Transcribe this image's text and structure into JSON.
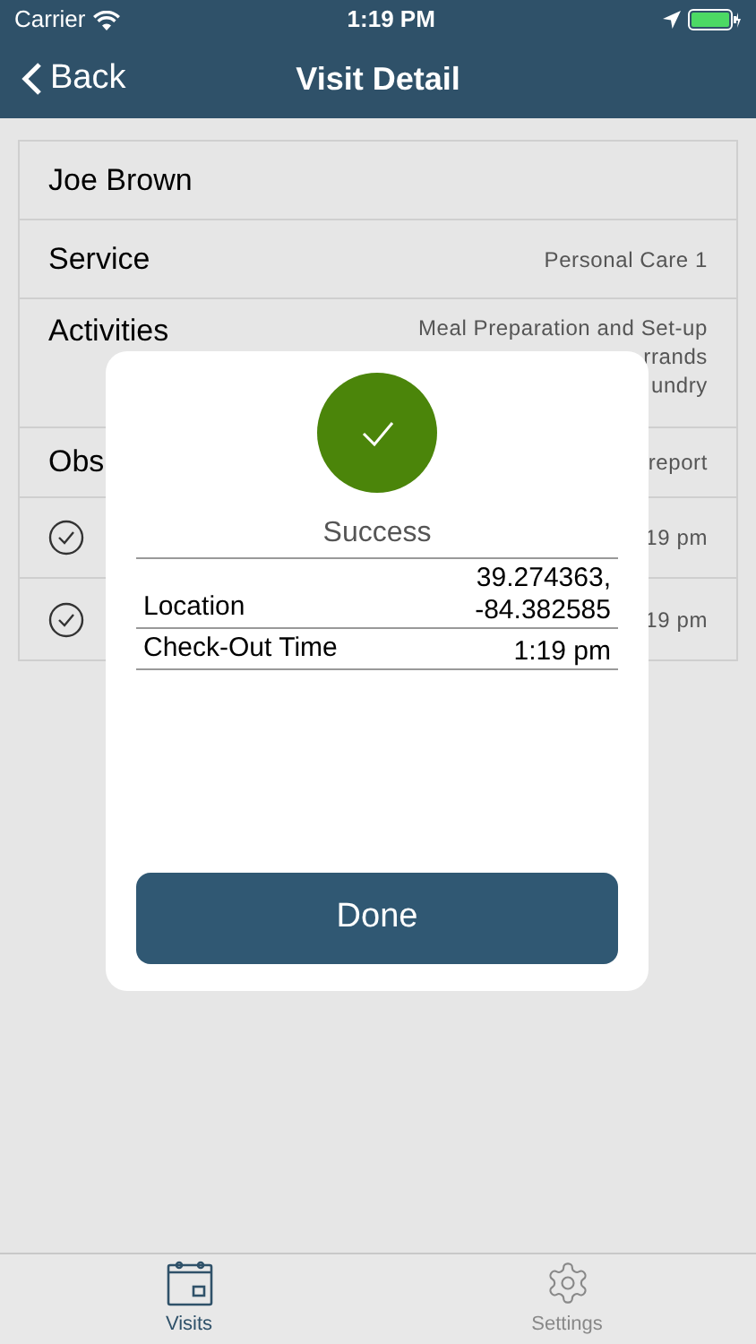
{
  "status_bar": {
    "carrier": "Carrier",
    "time": "1:19 PM"
  },
  "nav": {
    "back": "Back",
    "title": "Visit Detail"
  },
  "rows": [
    {
      "kind": "plain",
      "label": "Joe Brown"
    },
    {
      "kind": "pair",
      "label": "Service",
      "value": [
        "Personal Care 1"
      ]
    },
    {
      "kind": "pair",
      "label": "Activities",
      "value": [
        "Meal Preparation and Set-up",
        "rrands",
        "undry"
      ]
    },
    {
      "kind": "pair",
      "label": "Obs",
      "value": [
        "report"
      ]
    },
    {
      "kind": "check",
      "value": [
        "19 pm"
      ]
    },
    {
      "kind": "check",
      "value": [
        "19 pm"
      ]
    }
  ],
  "dialog": {
    "title": "Success",
    "fields": [
      {
        "label": "Location",
        "value": "39.274363,\n-84.382585"
      },
      {
        "label": "Check-Out Time",
        "value": "1:19 pm"
      }
    ],
    "button": "Done"
  },
  "tabs": [
    {
      "label": "Visits",
      "selected": true
    },
    {
      "label": "Settings",
      "selected": false
    }
  ]
}
